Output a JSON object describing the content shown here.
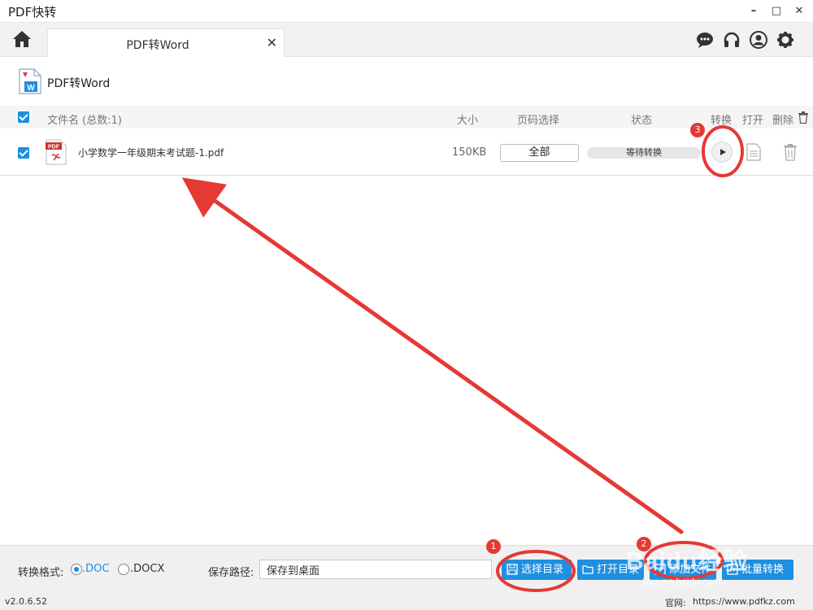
{
  "window": {
    "title": "PDF快转",
    "minimize": "–",
    "maximize": "□",
    "close": "✕"
  },
  "tab": {
    "label": "PDF转Word",
    "close": "✕"
  },
  "section": {
    "title": "PDF转Word"
  },
  "list": {
    "headers": {
      "filename": "文件名 (总数:1)",
      "size": "大小",
      "page_select": "页码选择",
      "status": "状态",
      "convert": "转换",
      "open": "打开",
      "delete": "删除"
    },
    "rows": [
      {
        "filename": "小学数学一年级期末考试题-1.pdf",
        "size": "150KB",
        "pages": "全部",
        "status": "等待转换"
      }
    ]
  },
  "footer": {
    "format_label": "转换格式:",
    "format_doc": ".DOC",
    "format_docx": ".DOCX",
    "save_path_label": "保存路径:",
    "save_path_value": "保存到桌面",
    "btn_select_dir": "选择目录",
    "btn_open_dir": "打开目录",
    "btn_add_file": "添加文件",
    "btn_batch": "批量转换"
  },
  "statusline": {
    "version": "v2.0.6.52",
    "site_label": "官网:",
    "site_url": "https://www.pdfkz.com"
  },
  "annotations": {
    "badge1": "1",
    "badge2": "2",
    "badge3": "3",
    "watermark": "Baidu经验",
    "watermark_sub": "jingyan.baidu.com"
  },
  "colors": {
    "accent": "#1f8fe0",
    "annotation": "#e53935"
  }
}
